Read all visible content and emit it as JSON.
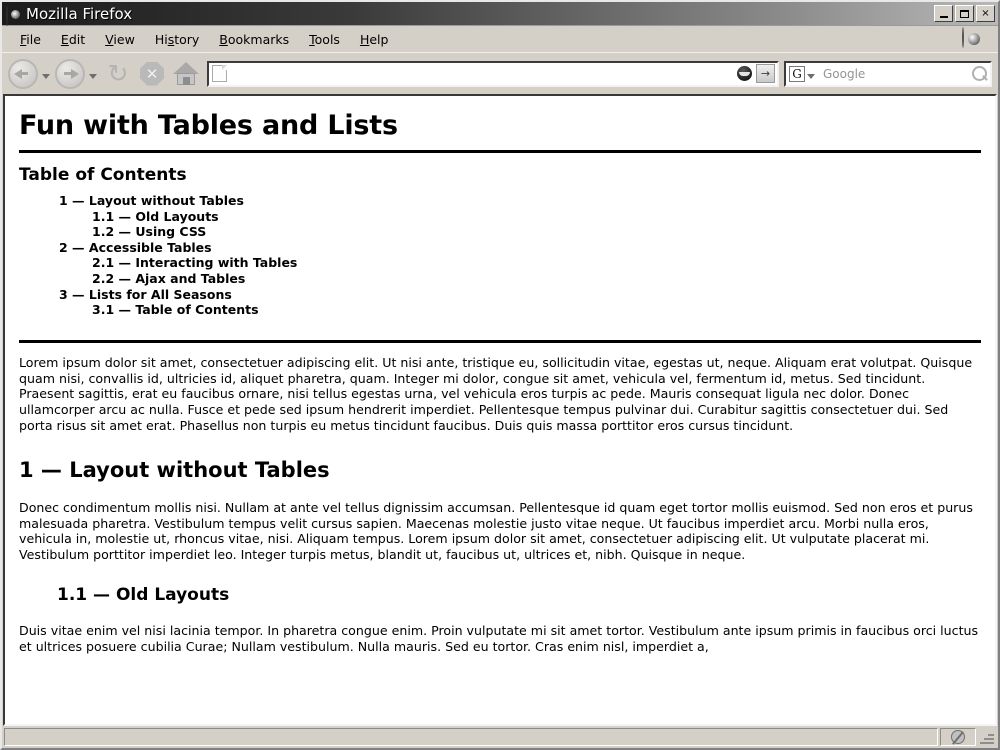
{
  "window": {
    "title": "Mozilla Firefox",
    "controls": {
      "minimize": "_",
      "maximize": "□",
      "close": "×"
    }
  },
  "menubar": {
    "items": [
      {
        "label": "File",
        "accel": "F"
      },
      {
        "label": "Edit",
        "accel": "E"
      },
      {
        "label": "View",
        "accel": "V"
      },
      {
        "label": "History",
        "accel": "s"
      },
      {
        "label": "Bookmarks",
        "accel": "B"
      },
      {
        "label": "Tools",
        "accel": "T"
      },
      {
        "label": "Help",
        "accel": "H"
      }
    ]
  },
  "toolbar": {
    "back_label": "Back",
    "forward_label": "Forward",
    "reload_label": "Reload",
    "stop_label": "Stop",
    "stop_glyph": "✕",
    "home_label": "Home",
    "reload_glyph": "↻",
    "go_glyph": "→"
  },
  "urlbar": {
    "value": "",
    "placeholder": "",
    "favicon": "blank-page-icon",
    "feed_icon": "rss-icon",
    "go_icon": "go-icon"
  },
  "searchbar": {
    "engine": "G",
    "engine_name": "Google",
    "placeholder": "Google",
    "value": "",
    "dropdown_icon": "chevron-down-icon",
    "search_icon": "magnifier-icon"
  },
  "page": {
    "title": "Fun with Tables and Lists",
    "toc_heading": "Table of Contents",
    "toc": [
      {
        "label": "1 — Layout without Tables",
        "level": 1
      },
      {
        "label": "1.1 — Old Layouts",
        "level": 2
      },
      {
        "label": "1.2 — Using CSS",
        "level": 2
      },
      {
        "label": "2 — Accessible Tables",
        "level": 1
      },
      {
        "label": "2.1 — Interacting with Tables",
        "level": 2
      },
      {
        "label": "2.2 — Ajax and Tables",
        "level": 2
      },
      {
        "label": "3 — Lists for All Seasons",
        "level": 1
      },
      {
        "label": "3.1 — Table of Contents",
        "level": 2
      }
    ],
    "intro_paragraph": "Lorem ipsum dolor sit amet, consectetuer adipiscing elit. Ut nisi ante, tristique eu, sollicitudin vitae, egestas ut, neque. Aliquam erat volutpat. Quisque quam nisi, convallis id, ultricies id, aliquet pharetra, quam. Integer mi dolor, congue sit amet, vehicula vel, fermentum id, metus. Sed tincidunt. Praesent sagittis, erat eu faucibus ornare, nisi tellus egestas urna, vel vehicula eros turpis ac pede. Mauris consequat ligula nec dolor. Donec ullamcorper arcu ac nulla. Fusce et pede sed ipsum hendrerit imperdiet. Pellentesque tempus pulvinar dui. Curabitur sagittis consectetuer dui. Sed porta risus sit amet erat. Phasellus non turpis eu metus tincidunt faucibus. Duis quis massa porttitor eros cursus tincidunt.",
    "section1_heading": "1 — Layout without Tables",
    "section1_paragraph": "Donec condimentum mollis nisi. Nullam at ante vel tellus dignissim accumsan. Pellentesque id quam eget tortor mollis euismod. Sed non eros et purus malesuada pharetra. Vestibulum tempus velit cursus sapien. Maecenas molestie justo vitae neque. Ut faucibus imperdiet arcu. Morbi nulla eros, vehicula in, molestie ut, rhoncus vitae, nisi. Aliquam tempus. Lorem ipsum dolor sit amet, consectetuer adipiscing elit. Ut vulputate placerat mi. Vestibulum porttitor imperdiet leo. Integer turpis metus, blandit ut, faucibus ut, ultrices et, nibh. Quisque in neque.",
    "subsection11_heading": "1.1 — Old Layouts",
    "subsection11_paragraph": "Duis vitae enim vel nisi lacinia tempor. In pharetra congue enim. Proin vulputate mi sit amet tortor. Vestibulum ante ipsum primis in faucibus orci luctus et ultrices posuere cubilia Curae; Nullam vestibulum. Nulla mauris. Sed eu tortor. Cras enim nisl, imperdiet a,"
  },
  "statusbar": {
    "message": "",
    "security_icon": "no-entry-icon",
    "resize_grip": "resize-grip-icon"
  },
  "colors": {
    "titlebar_dark": "#1b1b1b",
    "chrome": "#d4d0c8",
    "page_bg": "#ffffff",
    "text": "#000000",
    "placeholder": "#949494"
  }
}
